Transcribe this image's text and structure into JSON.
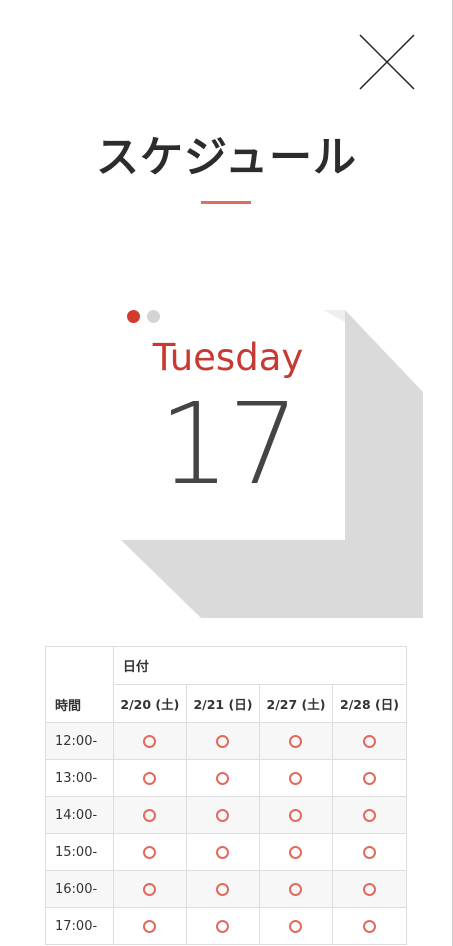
{
  "modal": {
    "title": "スケジュール",
    "close_icon": "close-icon"
  },
  "calendar": {
    "weekday": "Tuesday",
    "day": "17",
    "pager_dots": [
      "active",
      "inactive"
    ],
    "accent_color": "#d23a2e"
  },
  "schedule": {
    "time_header": "時間",
    "date_group_header": "日付",
    "dates": [
      "2/20 (土)",
      "2/21 (日)",
      "2/27 (土)",
      "2/28 (日)"
    ],
    "rows": [
      {
        "time": "12:00-",
        "marks": [
          "○",
          "○",
          "○",
          "○"
        ]
      },
      {
        "time": "13:00-",
        "marks": [
          "○",
          "○",
          "○",
          "○"
        ]
      },
      {
        "time": "14:00-",
        "marks": [
          "○",
          "○",
          "○",
          "○"
        ]
      },
      {
        "time": "15:00-",
        "marks": [
          "○",
          "○",
          "○",
          "○"
        ]
      },
      {
        "time": "16:00-",
        "marks": [
          "○",
          "○",
          "○",
          "○"
        ]
      },
      {
        "time": "17:00-",
        "marks": [
          "○",
          "○",
          "○",
          "○"
        ]
      }
    ],
    "mark_color": "#e06b5e"
  }
}
